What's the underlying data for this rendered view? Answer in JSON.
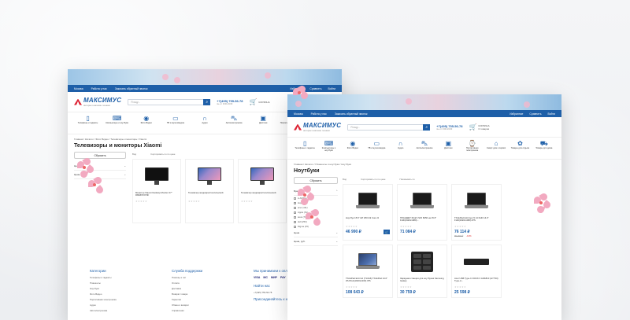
{
  "colors": {
    "brand": "#1e5fa8",
    "accent": "#d23a3a",
    "blossom": "#f2a9c0"
  },
  "common": {
    "nav": {
      "city": "Москва",
      "work": "Работа у нас",
      "callback": "Заказать обратный звонок",
      "fav": "Избранное",
      "compare": "Сравнить",
      "login": "Войти"
    },
    "logo": {
      "name": "МАКСИМУС",
      "tag": "интернет-магазин техники"
    },
    "search_placeholder": "Я ищу...",
    "phone": "+7(495) 755-56-78",
    "phone_sub": "пн–пт 9:00-19:00",
    "cart_label": "КОРЗИНА",
    "cart_items": "0 товаров",
    "categories": [
      {
        "label": "Телефоны и гаджеты",
        "icon": "phone-icon"
      },
      {
        "label": "Компьютеры и ноутбуки",
        "icon": "laptop-icon"
      },
      {
        "label": "Фото Видео",
        "icon": "camera-icon"
      },
      {
        "label": "ТВ и мультимедиа",
        "icon": "tv-icon"
      },
      {
        "label": "Аудио",
        "icon": "headphones-icon"
      },
      {
        "label": "Автоэлектроника",
        "icon": "car-icon"
      },
      {
        "label": "Дисплеи",
        "icon": "display-icon"
      },
      {
        "label": "Портативная электроника",
        "icon": "watch-icon"
      },
      {
        "label": "Смарт дом и сервис",
        "icon": "home-icon"
      },
      {
        "label": "Товары для отдыха",
        "icon": "gift-icon"
      },
      {
        "label": "Товары для дома",
        "icon": "cart-icon"
      }
    ]
  },
  "back": {
    "crumbs": "Главная / Каталог / Фото Видео / Телевизоры и мониторы / Xiaomi",
    "title": "Телевизоры и мониторы Xiaomi",
    "filter_btn": "Сбросить",
    "filters": [
      "Цена",
      "Цена, руб."
    ],
    "sort_label": "Сортировать по",
    "sort_value": "по цене",
    "show_label": "Вид",
    "products": [
      {
        "name": "Монитор Xiaomi Desktop Monitor 27\" RMMNT27NF",
        "type": "monitor-dark"
      },
      {
        "name": "Телевизор жидкокристаллический",
        "type": "monitor-blue"
      },
      {
        "name": "Телевизор жидкокристаллический",
        "type": "monitor-blue"
      }
    ],
    "footer": {
      "col1": {
        "title": "Категории",
        "links": [
          "Телефоны и гаджеты",
          "Планшеты",
          "Ноутбуки",
          "Фото Видео",
          "Портативная электроника",
          "Аудио",
          "Автоэлектроника"
        ]
      },
      "col2": {
        "title": "Служба поддержки",
        "links": [
          "Помощь и чат",
          "Оплата",
          "Доставка",
          "Возврат товара",
          "Гарантия",
          "Обмен и возврат",
          "Справочная"
        ]
      },
      "col3": {
        "title": "Мы принимаем к оплате",
        "pay": [
          "VISA",
          "MC",
          "МИР",
          "PAY"
        ],
        "find_title": "Найти нас",
        "find_phone": "+7(495) 755-56-78",
        "join_title": "Присоединяйтесь к нам"
      }
    }
  },
  "front": {
    "crumbs": "Главная / Каталог / Планшеты и ноутбуки / Ноутбуки",
    "title": "Ноутбуки",
    "filter_btn": "Сбросить",
    "brand_filter": "Бренд",
    "brands": [
      "A-NORA (5)",
      "Ноумо (3)",
      "acer (411)",
      "Apple (51)",
      "asus (717)",
      "dell (253)",
      "Digma (15)"
    ],
    "filters_more": [
      "Цена",
      "Цена, руб."
    ],
    "show_label": "Вид",
    "sort_label": "Сортировать по",
    "sort_value": "по цене",
    "sort2_label": "Показывать по",
    "products": [
      {
        "name": "Ноутбук 15.6\" HP 250 G9 Core i3",
        "price": "46 990 ₽",
        "old": "",
        "disc": "",
        "type": "laptop-dark"
      },
      {
        "name": "ПЛАНШЕТ IFLEY-S15 8256 на 15.6\" FHD(1920x1080)...",
        "price": "71 084 ₽",
        "old": "",
        "disc": "",
        "type": "laptop-dark"
      },
      {
        "name": "ThinkPad E14 Gen 5 14 FHD 14.0\" FHD(1920x1080) IPS",
        "price": "76 114 ₽",
        "old": "85 999 ₽",
        "disc": "-12%",
        "type": "laptop-dark"
      },
      {
        "name": "ThinkPad E14 G2 (T14G6) ThinkPad 14.0\" WUXGA(1920x1200) IPS",
        "price": "108 643 ₽",
        "old": "",
        "disc": "",
        "type": "laptop-blue"
      },
      {
        "name": "Зарядная станция для ноутбуков Samsung Galaxy",
        "price": "30 759 ₽",
        "old": "",
        "disc": "",
        "type": "case"
      },
      {
        "name": "Acer USB Type-C DOCK II ADK810 (HYT30) Type-A...",
        "price": "25 598 ₽",
        "old": "",
        "disc": "",
        "type": "dock"
      }
    ]
  }
}
